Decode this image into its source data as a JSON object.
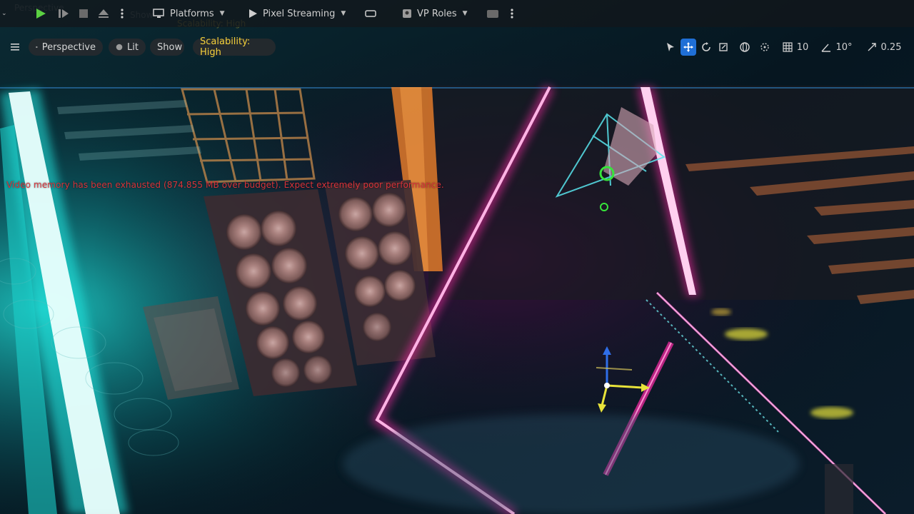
{
  "toolbar": {
    "platforms_label": "Platforms",
    "pixel_streaming_label": "Pixel Streaming",
    "vp_roles_label": "VP Roles"
  },
  "viewport_toolbar": {
    "perspective_label": "Perspective",
    "lit_label": "Lit",
    "show_label": "Show",
    "scalability_label": "Scalability: High",
    "grid_snap_value": "10",
    "angle_snap_value": "10°",
    "scale_snap_value": "0.25"
  },
  "warning_text": "Video memory has been exhausted (874.855 MB over budget). Expect extremely poor performance.",
  "colors": {
    "accent_blue": "#1f6fd6",
    "scalability_yellow": "#f2cf3b",
    "warning_red": "#d8333a",
    "neon_pink": "#ff2aa8",
    "neon_cyan": "#25e6e0"
  }
}
